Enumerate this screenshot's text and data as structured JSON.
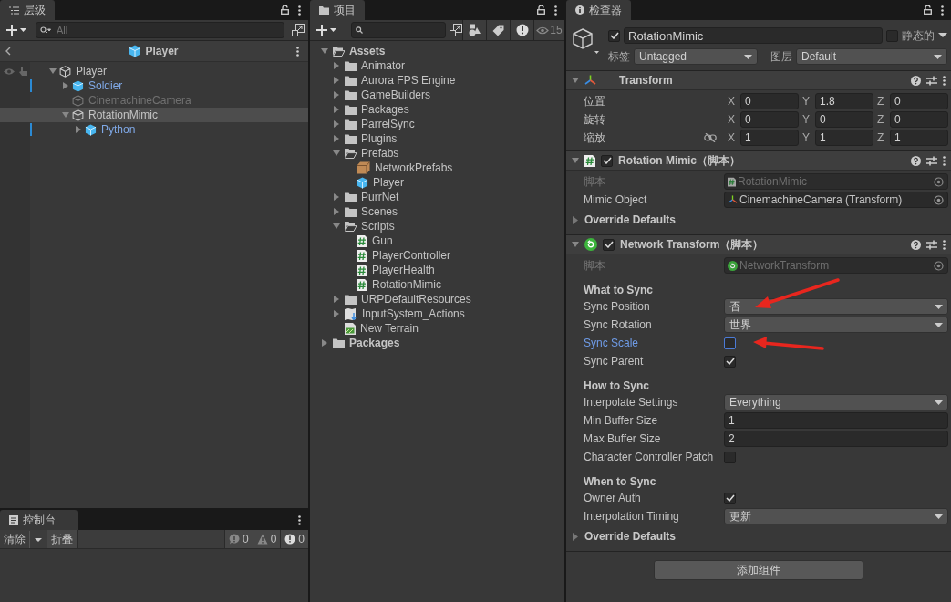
{
  "hierarchy": {
    "tab": "层级",
    "search": {
      "placeholder": "All"
    },
    "breadcrumb": "Player",
    "tree": [
      {
        "label": "Player",
        "kind": "object",
        "expanded": true,
        "active": true,
        "selected": false,
        "children": [
          {
            "label": "Soldier",
            "kind": "prefab",
            "expanded": false,
            "active": true,
            "selected": false
          },
          {
            "label": "CinemachineCamera",
            "kind": "object",
            "active": false,
            "selected": false
          },
          {
            "label": "RotationMimic",
            "kind": "object",
            "expanded": true,
            "active": true,
            "selected": true,
            "children": [
              {
                "label": "Python",
                "kind": "prefab",
                "expanded": false,
                "active": true,
                "selected": false
              }
            ]
          }
        ]
      }
    ]
  },
  "console": {
    "tab": "控制台",
    "clear_button": "清除",
    "collapse_button": "折叠",
    "counts": [
      {
        "kind": "info",
        "value": "0"
      },
      {
        "kind": "warning",
        "value": "0"
      },
      {
        "kind": "error",
        "value": "0"
      }
    ]
  },
  "project": {
    "tab": "项目",
    "hidden_count": "15",
    "tree": [
      {
        "label": "Assets",
        "kind": "folder",
        "expanded": true,
        "children": [
          {
            "label": "Animator",
            "kind": "folder",
            "expanded": false
          },
          {
            "label": "Aurora FPS Engine",
            "kind": "folder",
            "expanded": false
          },
          {
            "label": "GameBuilders",
            "kind": "folder",
            "expanded": false
          },
          {
            "label": "Packages",
            "kind": "folder",
            "expanded": false
          },
          {
            "label": "ParrelSync",
            "kind": "folder",
            "expanded": false
          },
          {
            "label": "Plugins",
            "kind": "folder",
            "expanded": false
          },
          {
            "label": "Prefabs",
            "kind": "folder",
            "expanded": true,
            "children": [
              {
                "label": "NetworkPrefabs",
                "kind": "asset-box"
              },
              {
                "label": "Player",
                "kind": "prefab"
              }
            ]
          },
          {
            "label": "PurrNet",
            "kind": "folder",
            "expanded": false
          },
          {
            "label": "Scenes",
            "kind": "folder",
            "expanded": false
          },
          {
            "label": "Scripts",
            "kind": "folder",
            "expanded": true,
            "children": [
              {
                "label": "Gun",
                "kind": "script"
              },
              {
                "label": "PlayerController",
                "kind": "script"
              },
              {
                "label": "PlayerHealth",
                "kind": "script"
              },
              {
                "label": "RotationMimic",
                "kind": "script"
              }
            ]
          },
          {
            "label": "URPDefaultResources",
            "kind": "folder",
            "expanded": false
          },
          {
            "label": "InputSystem_Actions",
            "kind": "input-actions",
            "expanded": false
          },
          {
            "label": "New Terrain",
            "kind": "terrain"
          }
        ]
      },
      {
        "label": "Packages",
        "kind": "folder",
        "expanded": false
      }
    ]
  },
  "inspector": {
    "tab": "检查器",
    "object_name": "RotationMimic",
    "active": true,
    "static_label": "静态的",
    "static": false,
    "tag_label": "标签",
    "tag": "Untagged",
    "layer_label": "图层",
    "layer": "Default",
    "components": [
      {
        "kind": "transform",
        "title": "Transform",
        "expanded": true,
        "rows": [
          {
            "label": "位置",
            "values": [
              {
                "axis": "X",
                "value": "0"
              },
              {
                "axis": "Y",
                "value": "1.8"
              },
              {
                "axis": "Z",
                "value": "0"
              }
            ]
          },
          {
            "label": "旋转",
            "values": [
              {
                "axis": "X",
                "value": "0"
              },
              {
                "axis": "Y",
                "value": "0"
              },
              {
                "axis": "Z",
                "value": "0"
              }
            ]
          },
          {
            "label": "缩放",
            "proportional": false,
            "values": [
              {
                "axis": "X",
                "value": "1"
              },
              {
                "axis": "Y",
                "value": "1"
              },
              {
                "axis": "Z",
                "value": "1"
              }
            ]
          }
        ]
      },
      {
        "kind": "script",
        "title": "Rotation Mimic（脚本）",
        "enabled": true,
        "expanded": true,
        "fields": [
          {
            "kind": "script",
            "label": "脚本",
            "value": "RotationMimic"
          },
          {
            "kind": "object",
            "label": "Mimic Object",
            "value": "CinemachineCamera (Transform)"
          },
          {
            "kind": "foldout",
            "label": "Override Defaults",
            "expanded": false
          }
        ]
      },
      {
        "kind": "network-script",
        "title": "Network Transform（脚本）",
        "enabled": true,
        "expanded": true,
        "fields": [
          {
            "kind": "script",
            "label": "脚本",
            "value": "NetworkTransform"
          },
          {
            "kind": "header",
            "label": "What to Sync"
          },
          {
            "kind": "dropdown",
            "label": "Sync Position",
            "value": "否",
            "arrow_callout": true
          },
          {
            "kind": "dropdown",
            "label": "Sync Rotation",
            "value": "世界"
          },
          {
            "kind": "checkbox",
            "label": "Sync Scale",
            "checked": false,
            "focused": true,
            "arrow_callout": true
          },
          {
            "kind": "checkbox",
            "label": "Sync Parent",
            "checked": true,
            "focused": false
          },
          {
            "kind": "header",
            "label": "How to Sync"
          },
          {
            "kind": "dropdown",
            "label": "Interpolate Settings",
            "value": "Everything"
          },
          {
            "kind": "number",
            "label": "Min Buffer Size",
            "value": "1"
          },
          {
            "kind": "number",
            "label": "Max Buffer Size",
            "value": "2"
          },
          {
            "kind": "checkbox",
            "label": "Character Controller Patch",
            "checked": false,
            "focused": false
          },
          {
            "kind": "header",
            "label": "When to Sync"
          },
          {
            "kind": "checkbox",
            "label": "Owner Auth",
            "checked": true,
            "focused": false
          },
          {
            "kind": "dropdown",
            "label": "Interpolation Timing",
            "value": "更新"
          },
          {
            "kind": "foldout",
            "label": "Override Defaults",
            "expanded": false
          }
        ]
      }
    ],
    "add_component_button": "添加组件"
  }
}
